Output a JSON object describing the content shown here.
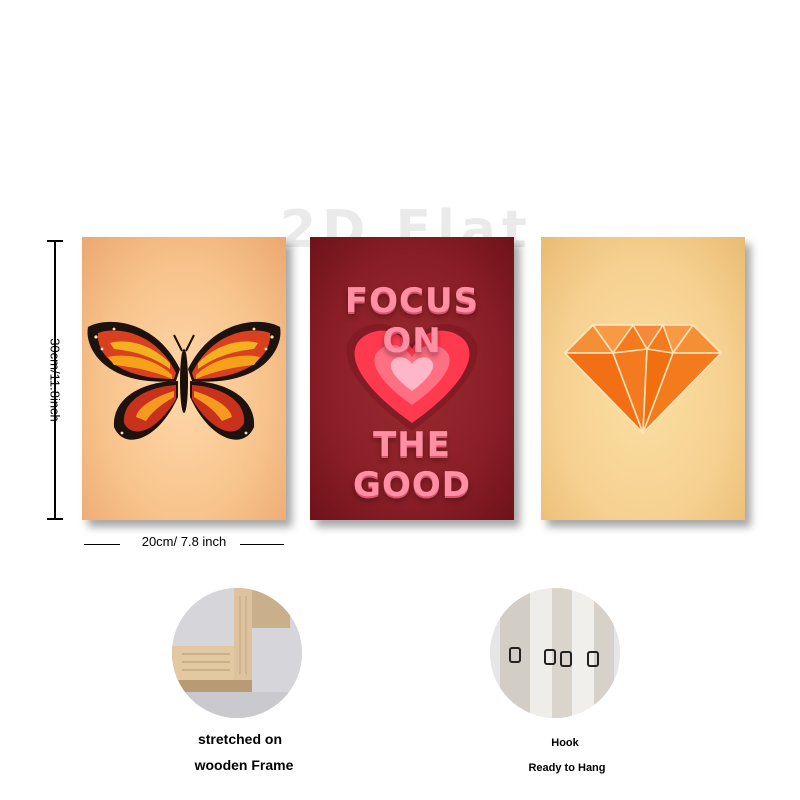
{
  "watermark": "2D Flat",
  "posters": {
    "center": {
      "line1": "FOCUS ON",
      "line2": "THE GOOD"
    }
  },
  "dimensions": {
    "height_label": "30cm/11.8inch",
    "width_label": "20cm/ 7.8 inch"
  },
  "features": {
    "frame": {
      "line1": "stretched on",
      "line2": "wooden Frame"
    },
    "hook": {
      "line1": "Hook",
      "line2": "Ready to Hang"
    }
  },
  "colors": {
    "poster_left_bg": "#f8c48d",
    "poster_center_bg": "#8a1e27",
    "poster_right_bg": "#f6d090",
    "heart_outer": "#ff3a4f",
    "heart_inner": "#ffb6c6",
    "diamond": "#f47a1f"
  },
  "icons": [
    "butterfly-icon",
    "heart-icon",
    "diamond-icon"
  ]
}
